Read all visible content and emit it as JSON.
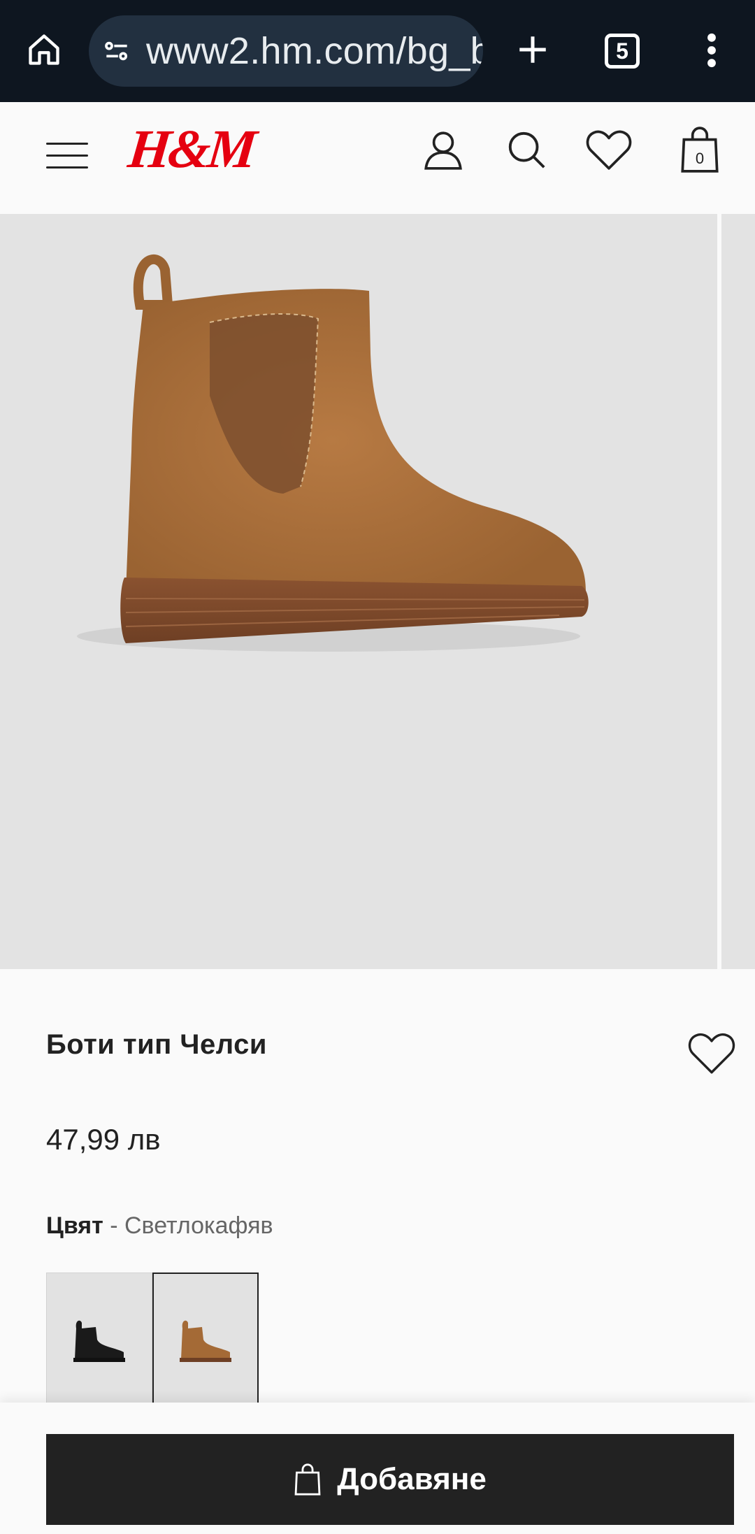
{
  "browser": {
    "url": "www2.hm.com/bg_bg",
    "tab_count": "5"
  },
  "header": {
    "logo": "H&M",
    "bag_count": "0"
  },
  "product": {
    "title": "Боти тип Челси",
    "price": "47,99 лв",
    "color_label": "Цвят",
    "color_value": "- Светлокафяв",
    "swatches": [
      {
        "color": "black",
        "selected": false
      },
      {
        "color": "light-brown",
        "selected": true
      }
    ]
  },
  "actions": {
    "add_label": "Добавяне"
  },
  "colors": {
    "brand": "#e50010",
    "browser_bar": "#0e1620",
    "button": "#222222"
  }
}
